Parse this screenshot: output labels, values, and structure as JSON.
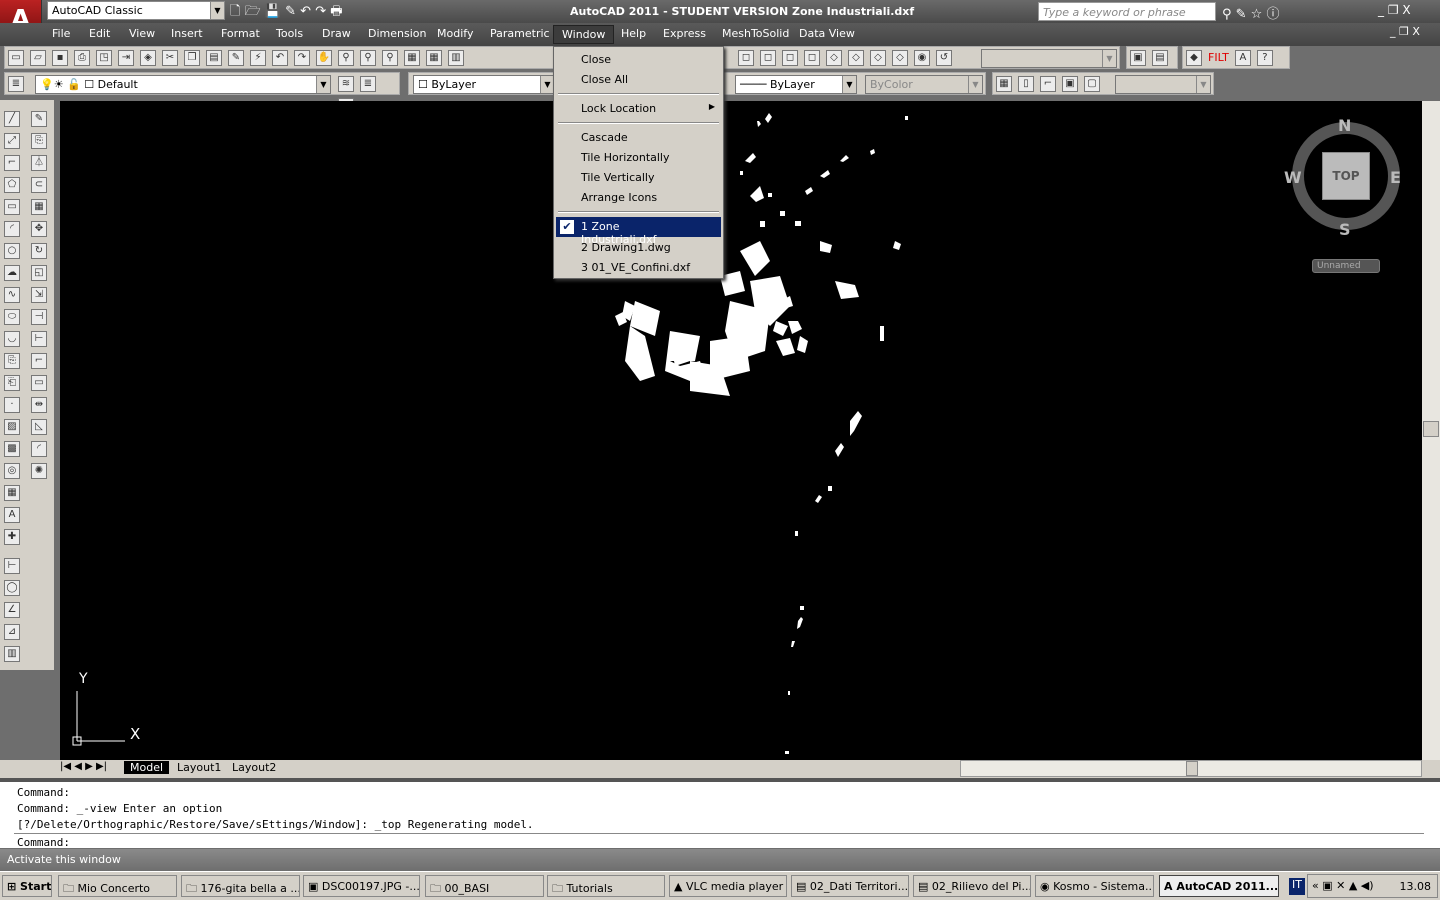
{
  "titlebar": {
    "workspace": "AutoCAD Classic",
    "title": "AutoCAD 2011 - STUDENT VERSION    Zone Industriali.dxf",
    "search_placeholder": "Type a keyword or phrase"
  },
  "menubar": [
    "File",
    "Edit",
    "View",
    "Insert",
    "Format",
    "Tools",
    "Draw",
    "Dimension",
    "Modify",
    "Parametric",
    "Window",
    "Help",
    "Express",
    "MeshToSolid",
    "Data View"
  ],
  "layers": {
    "layer": "Default",
    "color": "ByLayer",
    "linetype": "ByLayer",
    "plotstyle": "ByColor"
  },
  "window_menu": {
    "items": [
      "Close",
      "Close All",
      "Lock Location",
      "Cascade",
      "Tile Horizontally",
      "Tile Vertically",
      "Arrange Icons"
    ],
    "windows": [
      "1 Zone Industriali.dxf",
      "2 Drawing1.dwg",
      "3 01_VE_Confini.dxf"
    ],
    "checked": 0
  },
  "viewcube": {
    "n": "N",
    "s": "S",
    "e": "E",
    "w": "W",
    "face": "TOP",
    "ucs": "Unnamed"
  },
  "ucs": {
    "x": "X",
    "y": "Y"
  },
  "tabs": [
    "Model",
    "Layout1",
    "Layout2"
  ],
  "command": {
    "lines": [
      "Command:",
      "Command:  _-view Enter an option",
      "[?/Delete/Orthographic/Restore/Save/sEttings/Window]: _top Regenerating model."
    ],
    "prompt": "Command:"
  },
  "status": "Activate this window",
  "taskbar": {
    "start": "Start",
    "tasks": [
      "Mio Concerto",
      "176-gita bella a ...",
      "DSC00197.JPG -...",
      "00_BASI",
      "Tutorials",
      "VLC media player",
      "02_Dati Territori...",
      "02_Rilievo del Pi...",
      "Kosmo - Sistema...",
      "AutoCAD 2011..."
    ],
    "lang": "IT",
    "clock": "13.08"
  },
  "colors": {
    "canvas": "#000000",
    "menu_highlight": "#0a246a",
    "filt": "#e00000"
  }
}
